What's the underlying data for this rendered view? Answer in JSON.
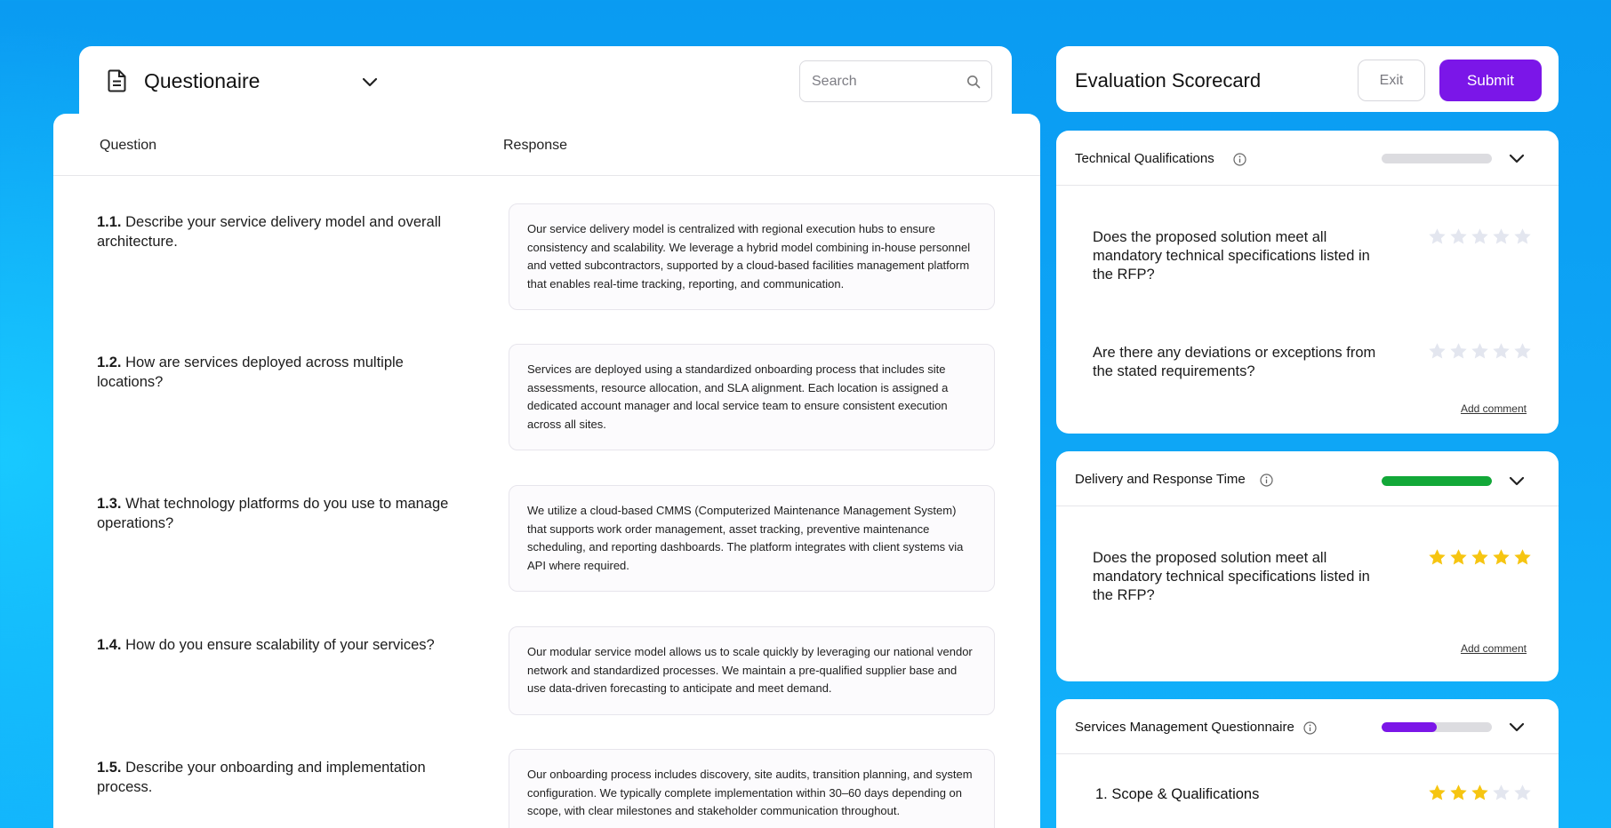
{
  "questionnaire": {
    "title": "Questionaire",
    "search_placeholder": "Search",
    "columns": {
      "question": "Question",
      "response": "Response"
    },
    "rows": [
      {
        "number": "1.1.",
        "question": "Describe your service delivery model and overall architecture.",
        "response": "Our service delivery model is centralized with regional execution hubs to ensure consistency and scalability. We leverage a hybrid model combining in-house personnel and vetted subcontractors, supported by a cloud-based facilities management platform that enables real-time tracking, reporting, and communication."
      },
      {
        "number": "1.2.",
        "question": "How are services deployed across multiple locations?",
        "response": "Services are deployed using a standardized onboarding process that includes site assessments, resource allocation, and SLA alignment. Each location is assigned a dedicated account manager and local service team to ensure consistent execution across all sites."
      },
      {
        "number": "1.3.",
        "question": "What technology platforms do you use to manage operations?",
        "response": "We utilize a cloud-based CMMS (Computerized Maintenance Management System) that supports work order management, asset tracking, preventive maintenance scheduling, and reporting dashboards. The platform integrates with client systems via API where required."
      },
      {
        "number": "1.4.",
        "question": "How do you ensure scalability of your services?",
        "response": "Our modular service model allows us to scale quickly by leveraging our national vendor network and standardized processes. We maintain a pre-qualified supplier base and use data-driven forecasting to anticipate and meet demand."
      },
      {
        "number": "1.5.",
        "question": "Describe your onboarding and implementation process.",
        "response": "Our onboarding process includes discovery, site audits, transition planning, and system configuration. We typically complete implementation within 30–60 days depending on scope, with clear milestones and stakeholder communication throughout."
      }
    ]
  },
  "scorecard": {
    "title": "Evaluation Scorecard",
    "exit_label": "Exit",
    "submit_label": "Submit",
    "add_comment_label": "Add comment",
    "sections": [
      {
        "name": "Technical Qualifications",
        "progress": 0,
        "criteria": [
          {
            "text": "Does the proposed solution meet all mandatory technical specifications listed in the RFP?",
            "rating": 0
          },
          {
            "text": "Are there any deviations or exceptions from the stated requirements?",
            "rating": 0
          }
        ]
      },
      {
        "name": "Delivery and Response Time",
        "progress": 100,
        "criteria": [
          {
            "text": "Does the proposed solution meet all mandatory technical specifications listed in the RFP?",
            "rating": 5
          }
        ]
      },
      {
        "name": "Services Management Questionnaire",
        "progress": 50,
        "items": [
          {
            "label": "1. Scope & Qualifications",
            "rating": 3
          }
        ]
      }
    ]
  },
  "colors": {
    "accent": "#7b16e8",
    "progress_green": "#12a838",
    "progress_purple": "#7b16e8",
    "star_filled": "#f6c511",
    "star_empty": "#e3e6ef",
    "background": "#0ea5f6"
  },
  "icons": {
    "document": "document-icon",
    "chevron": "chevron-down-icon",
    "search": "search-icon",
    "info": "info-icon",
    "star": "star-icon"
  }
}
